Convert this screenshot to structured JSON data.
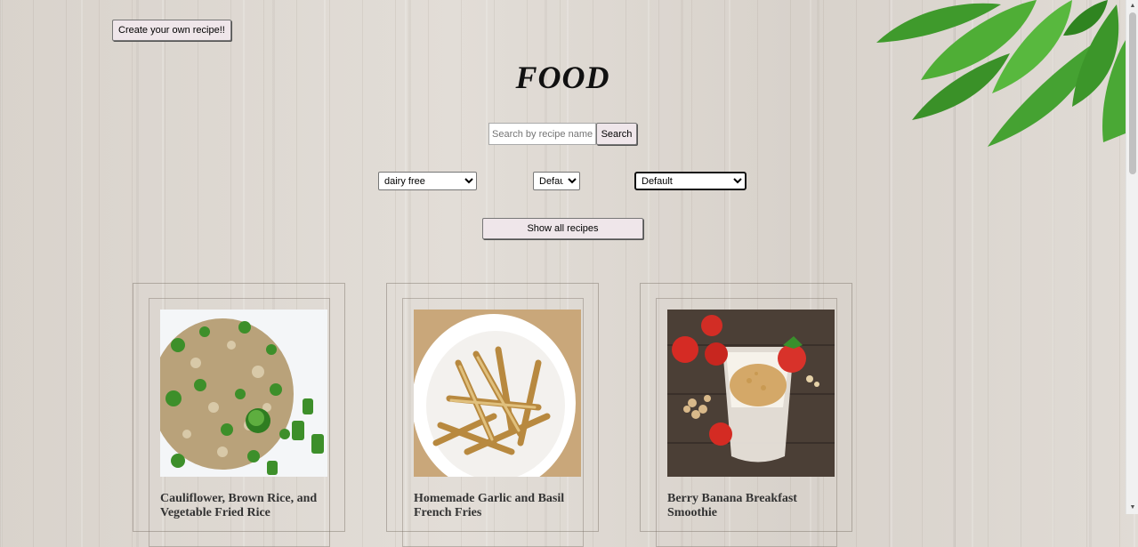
{
  "header": {
    "create_button_label": "Create your own recipe!!",
    "title": "FOOD"
  },
  "search": {
    "placeholder": "Search by recipe name...",
    "value": "",
    "button_label": "Search"
  },
  "filters": {
    "diet_selected": "dairy free",
    "sort_selected": "Default",
    "cuisine_selected": "Default"
  },
  "show_all_label": "Show all recipes",
  "recipes": [
    {
      "name": "Cauliflower, Brown Rice, and Vegetable Fried Rice"
    },
    {
      "name": "Homemade Garlic and Basil French Fries"
    },
    {
      "name": "Berry Banana Breakfast Smoothie"
    }
  ],
  "icons": {
    "decor": "leaves-decoration",
    "select_arrow": "chevron-down-icon"
  },
  "colors": {
    "button_bg": "#efe6ea",
    "background": "#ddd7d0"
  }
}
